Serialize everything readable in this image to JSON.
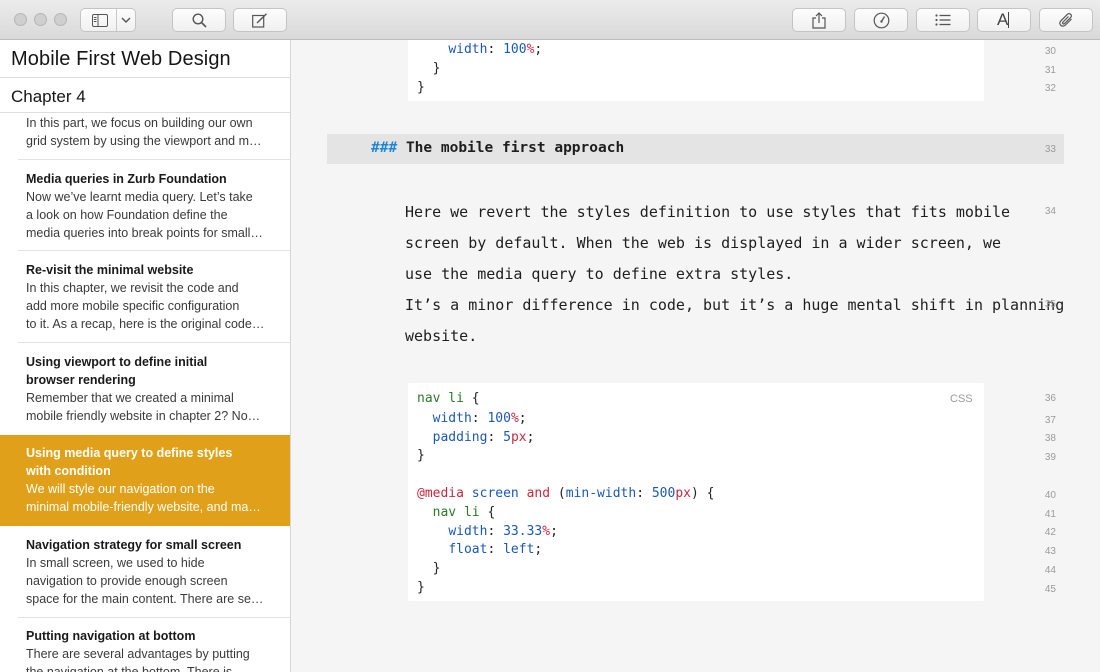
{
  "toolbar": {
    "buttons": [
      {
        "name": "sidebar-toggle",
        "icon": "sidebar-icon"
      },
      {
        "name": "sidebar-dropdown",
        "icon": "chevron-down-icon"
      },
      {
        "name": "search",
        "icon": "search-icon"
      },
      {
        "name": "compose",
        "icon": "compose-icon"
      },
      {
        "name": "share",
        "icon": "share-icon"
      },
      {
        "name": "goals",
        "icon": "gauge-icon"
      },
      {
        "name": "outline",
        "icon": "list-icon"
      },
      {
        "name": "typography",
        "icon": "font-icon"
      },
      {
        "name": "attachments",
        "icon": "paperclip-icon"
      }
    ],
    "font_glyph": "A"
  },
  "sidebar": {
    "book_title": "Mobile First Web Design",
    "chapter_title": "Chapter 4",
    "sheets": [
      {
        "title": "",
        "body": [
          "In this part, we focus on building our own",
          "grid system by using the viewport and m…"
        ]
      },
      {
        "title": "Media queries in Zurb Foundation",
        "body": [
          "Now we’ve learnt media query. Let’s take",
          "a look on how Foundation define the",
          "media queries into break points for small…"
        ]
      },
      {
        "title": "Re-visit the minimal website",
        "body": [
          "In this chapter, we revisit the code and",
          "add more mobile specific configuration",
          "to it. As a recap, here is the original code…"
        ]
      },
      {
        "title": "Using viewport to define initial\nbrowser rendering",
        "title_lines": [
          "Using viewport to define initial",
          "browser rendering"
        ],
        "body": [
          "Remember that we created a minimal",
          "mobile friendly website in chapter 2? No…"
        ]
      },
      {
        "title_lines": [
          "Using media query to define styles",
          "with condition"
        ],
        "body": [
          "We will style our navigation on the",
          "minimal mobile-friendly website, and ma…"
        ],
        "active": true
      },
      {
        "title": "Navigation strategy for small screen",
        "body": [
          "In small screen, we used to hide",
          "navigation to provide enough screen",
          "space for the main content. There are se…"
        ]
      },
      {
        "title": "Putting navigation at bottom",
        "body": [
          "There are several advantages by putting",
          "the navigation at the bottom. There is…"
        ]
      }
    ]
  },
  "editor": {
    "top_code": [
      "    width: 100%;",
      "  }",
      "}"
    ],
    "top_line_numbers": [
      "30",
      "31",
      "32"
    ],
    "heading": {
      "hash": "###",
      "text": "The mobile first approach",
      "line": "33"
    },
    "paragraph_lines": [
      "Here we revert the styles definition to use styles that fits mobile",
      "screen by default. When the web is displayed in a wider screen, we",
      "use the media query to define extra styles.",
      "It’s a minor difference in code, but it’s a huge mental shift in planning",
      "website."
    ],
    "paragraph_line_numbers": [
      "34",
      "35"
    ],
    "code_lang": "CSS",
    "code_line_numbers": [
      "36",
      "37",
      "38",
      "39",
      "40",
      "41",
      "42",
      "43",
      "44",
      "45"
    ],
    "code": {
      "l1_sel": "nav li",
      "l1_brace": " {",
      "l2_prop": "width",
      "l2_val": "100",
      "l2_unit": "%",
      "l3_prop": "padding",
      "l3_val": "5",
      "l3_unit": "px",
      "l4": "}",
      "l5_at": "@media",
      "l5_kw1": "screen",
      "l5_and": "and",
      "l5_feat": "min-width",
      "l5_val": "500",
      "l5_unit": "px",
      "l6_sel": "nav li",
      "l7_prop": "width",
      "l7_val": "33.33",
      "l7_unit": "%",
      "l8_prop": "float",
      "l8_val": "left",
      "l9": "}",
      "l10": "}"
    }
  }
}
